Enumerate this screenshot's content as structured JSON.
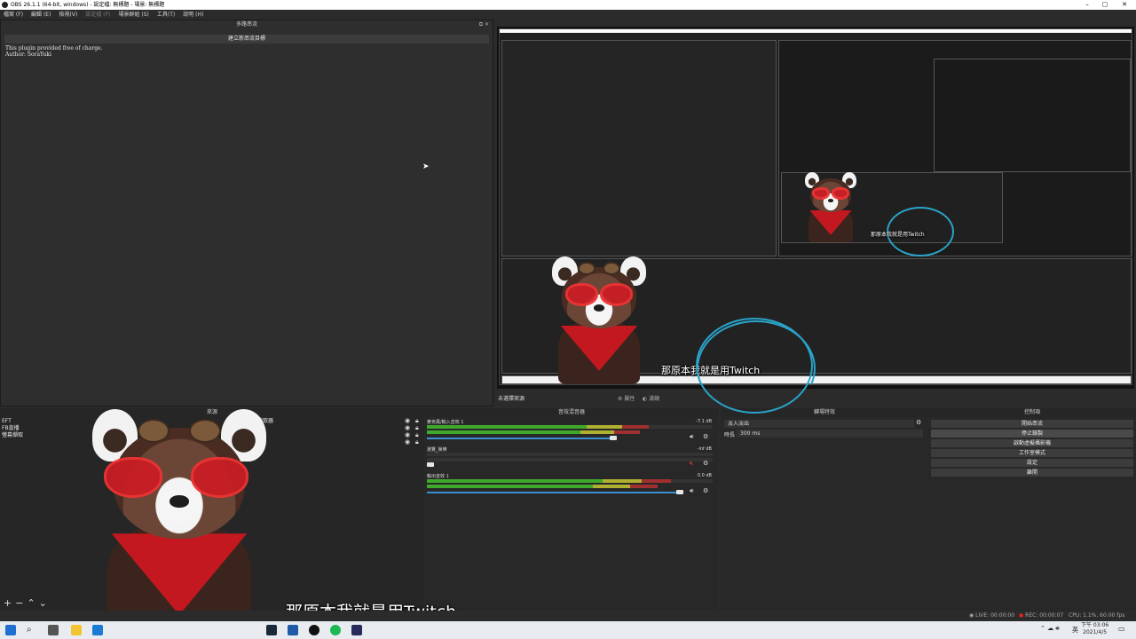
{
  "window": {
    "title": "OBS 26.1.1 (64-bit, windows) - 設定檔: 無標題 - 場景: 無標題",
    "minimize": "–",
    "maximize": "▢",
    "close": "✕"
  },
  "menu": [
    "檔案 (F)",
    "編輯 (E)",
    "檢視(V)",
    "設定檔 (P)",
    "場景群組 (S)",
    "工具(T)",
    "說明 (H)"
  ],
  "multiview": {
    "title": "多路串流",
    "create_button": "建立新串流目標",
    "plugin_line1": "This plugin provided free of charge.",
    "plugin_line2": "Author: SoraYuki"
  },
  "studio": {
    "label": "未選擇來源",
    "properties": "屬性",
    "filters": "濾鏡"
  },
  "docks": {
    "scenes_title": "來源",
    "mixer_title": "音效混音器",
    "transitions_title": "轉場特效",
    "controls_title": "控制項"
  },
  "sources": {
    "items": [
      "EFT",
      "FB直播",
      "螢幕擷取"
    ],
    "partial_right": "截取器"
  },
  "mixer": {
    "channels": [
      {
        "name": "麥克風/輸入音效 1",
        "db": "-7.1 dB",
        "volume": 0.73,
        "muted": false
      },
      {
        "name": "瀏覽_娛樂",
        "db": "-inf dB",
        "volume": 0.02,
        "muted": true
      },
      {
        "name": "輸出音效 1",
        "db": "0.0 dB",
        "volume": 0.97,
        "muted": false
      }
    ],
    "scale": [
      "-60",
      "-55",
      "-50",
      "-45",
      "-40",
      "-35",
      "-30",
      "-25",
      "-20",
      "-15",
      "-10",
      "-5",
      "0"
    ]
  },
  "transitions": {
    "selected": "淡入淡出",
    "duration_label": "時長",
    "duration_value": "300 ms"
  },
  "controls": {
    "buttons": [
      "開始串流",
      "停止錄製",
      "啟動虛擬攝影機",
      "工作室模式",
      "設定",
      "離開"
    ]
  },
  "status": {
    "live": "LIVE: 00:00:00",
    "rec": "REC: 00:00:07",
    "cpu": "CPU: 1.1%, 60.00 fps"
  },
  "taskbar": {
    "time": "下午 03:06",
    "date": "2021/4/5",
    "ime": "英"
  },
  "subtitles": {
    "inner": "那原本我就是用Twitch",
    "main": "那原本我就是用Twitch",
    "nested": "那原本我就是用Twitch"
  },
  "colors": {
    "accent_ring": "#29a3c9",
    "bandana": "#c3181f",
    "glasses": "#c81d25",
    "meter_green": "#3fa92b",
    "volume_blue": "#3a8fd0"
  }
}
